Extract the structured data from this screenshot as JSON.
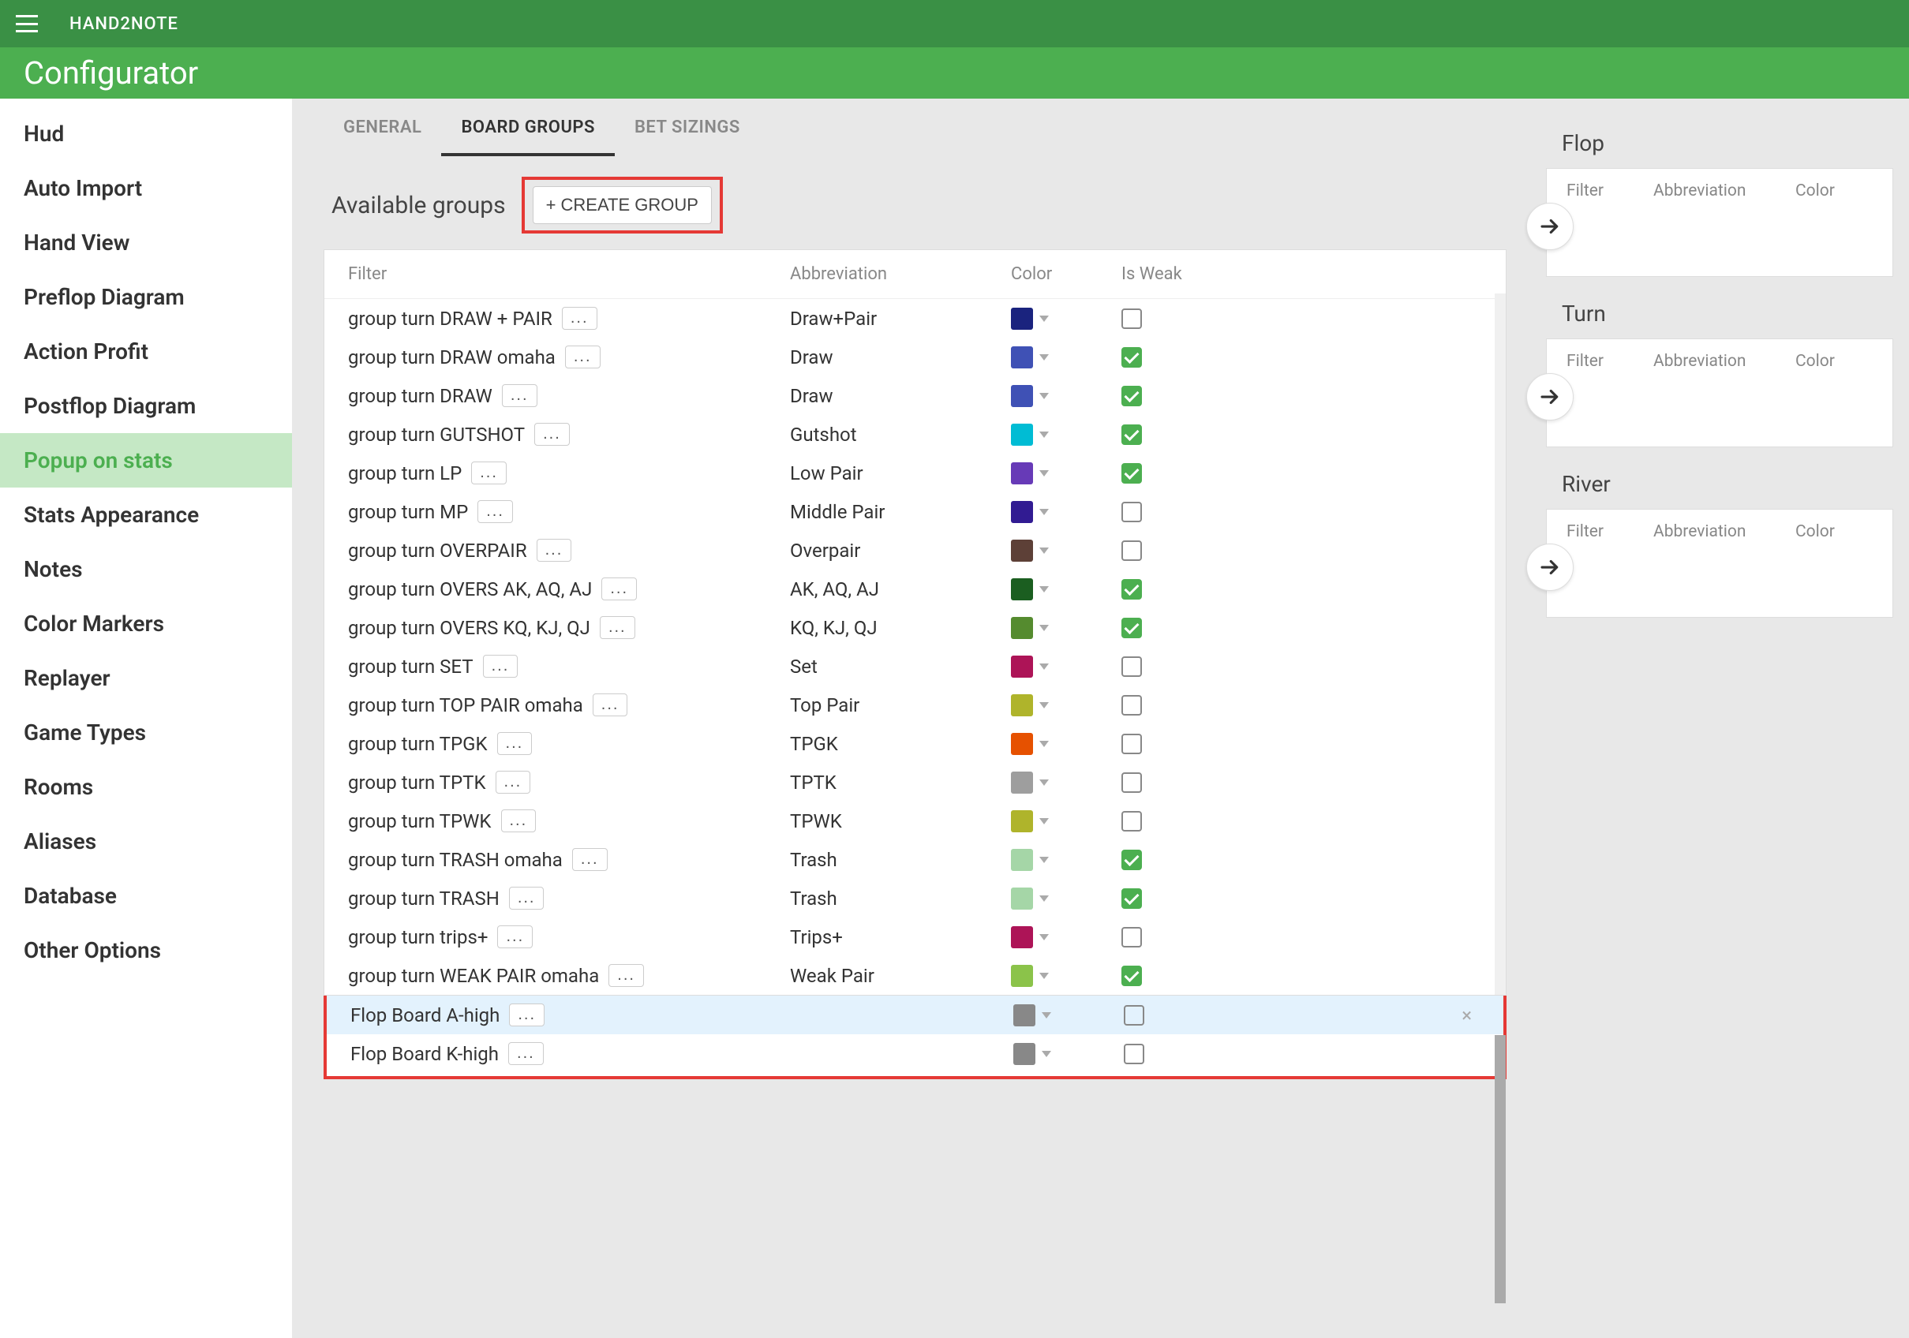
{
  "app": {
    "title": "HAND2NOTE",
    "section": "Configurator"
  },
  "sidebar": {
    "items": [
      {
        "label": "Hud"
      },
      {
        "label": "Auto Import"
      },
      {
        "label": "Hand View"
      },
      {
        "label": "Preflop Diagram"
      },
      {
        "label": "Action Profit"
      },
      {
        "label": "Postflop Diagram"
      },
      {
        "label": "Popup on stats",
        "active": true
      },
      {
        "label": "Stats Appearance"
      },
      {
        "label": "Notes"
      },
      {
        "label": "Color Markers"
      },
      {
        "label": "Replayer"
      },
      {
        "label": "Game Types"
      },
      {
        "label": "Rooms"
      },
      {
        "label": "Aliases"
      },
      {
        "label": "Database"
      },
      {
        "label": "Other Options"
      }
    ]
  },
  "tabs": [
    {
      "label": "GENERAL"
    },
    {
      "label": "BOARD GROUPS",
      "active": true
    },
    {
      "label": "BET SIZINGS"
    }
  ],
  "groups": {
    "title": "Available groups",
    "create_label": "+ CREATE GROUP",
    "headers": {
      "filter": "Filter",
      "abbr": "Abbreviation",
      "color": "Color",
      "weak": "Is Weak"
    },
    "rows": [
      {
        "filter": "group turn DRAW + PAIR",
        "abbr": "Draw+Pair",
        "color": "#1a237e",
        "weak": false
      },
      {
        "filter": "group turn DRAW omaha",
        "abbr": "Draw",
        "color": "#3f51b5",
        "weak": true
      },
      {
        "filter": "group turn DRAW",
        "abbr": "Draw",
        "color": "#3f51b5",
        "weak": true
      },
      {
        "filter": "group turn GUTSHOT",
        "abbr": "Gutshot",
        "color": "#00bcd4",
        "weak": true
      },
      {
        "filter": "group turn LP",
        "abbr": "Low Pair",
        "color": "#673ab7",
        "weak": true
      },
      {
        "filter": "group turn MP",
        "abbr": "Middle Pair",
        "color": "#311b92",
        "weak": false
      },
      {
        "filter": "group turn OVERPAIR",
        "abbr": "Overpair",
        "color": "#5d4037",
        "weak": false
      },
      {
        "filter": "group turn OVERS AK, AQ, AJ",
        "abbr": "AK, AQ, AJ",
        "color": "#1b5e20",
        "weak": true
      },
      {
        "filter": "group turn OVERS KQ, KJ, QJ",
        "abbr": "KQ, KJ, QJ",
        "color": "#558b2f",
        "weak": true
      },
      {
        "filter": "group turn SET",
        "abbr": "Set",
        "color": "#ad1457",
        "weak": false
      },
      {
        "filter": "group turn TOP PAIR omaha",
        "abbr": "Top Pair",
        "color": "#afb42b",
        "weak": false
      },
      {
        "filter": "group turn TPGK",
        "abbr": "TPGK",
        "color": "#e65100",
        "weak": false
      },
      {
        "filter": "group turn TPTK",
        "abbr": "TPTK",
        "color": "#9e9e9e",
        "weak": false
      },
      {
        "filter": "group turn TPWK",
        "abbr": "TPWK",
        "color": "#afb42b",
        "weak": false
      },
      {
        "filter": "group turn TRASH omaha",
        "abbr": "Trash",
        "color": "#a5d6a7",
        "weak": true
      },
      {
        "filter": "group turn TRASH",
        "abbr": "Trash",
        "color": "#a5d6a7",
        "weak": true
      },
      {
        "filter": "group turn trips+",
        "abbr": "Trips+",
        "color": "#ad1457",
        "weak": false
      },
      {
        "filter": "group turn WEAK PAIR omaha",
        "abbr": "Weak Pair",
        "color": "#8bc34a",
        "weak": true
      }
    ],
    "highlighted_rows": [
      {
        "filter": "Flop Board A-high",
        "abbr": "",
        "color": "#888888",
        "weak": false,
        "selected": true
      },
      {
        "filter": "Flop Board K-high",
        "abbr": "",
        "color": "#888888",
        "weak": false
      }
    ]
  },
  "streets": {
    "headers": {
      "filter": "Filter",
      "abbr": "Abbreviation",
      "color": "Color"
    },
    "sections": [
      {
        "title": "Flop"
      },
      {
        "title": "Turn"
      },
      {
        "title": "River"
      }
    ]
  },
  "dots": "..."
}
